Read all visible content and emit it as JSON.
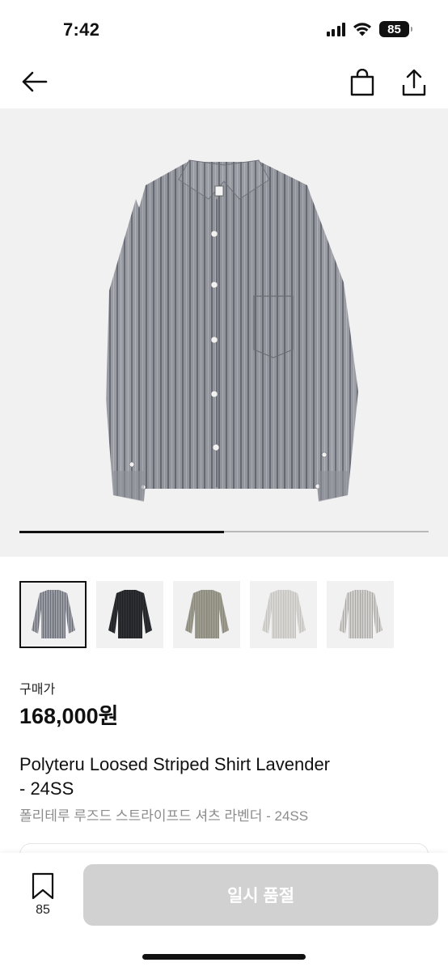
{
  "status_bar": {
    "time": "7:42",
    "battery": "85"
  },
  "nav": {
    "back_icon": "arrow-left-icon",
    "bag_icon": "shopping-bag-icon",
    "share_icon": "share-icon"
  },
  "hero": {
    "image": "gray-striped-shirt",
    "progress": 0.5
  },
  "thumbnails": [
    {
      "color": "gray-stripe",
      "selected": true
    },
    {
      "color": "black",
      "selected": false
    },
    {
      "color": "khaki",
      "selected": false
    },
    {
      "color": "light-gray",
      "selected": false
    },
    {
      "color": "light-gray-stripe",
      "selected": false
    }
  ],
  "price": {
    "label": "구매가",
    "value": "168,000원"
  },
  "product": {
    "title_en_line1": "Polyteru Loosed Striped Shirt Lavender",
    "title_en_line2": "- 24SS",
    "title_ko": "폴리테루 루즈드 스트라이프드 셔츠 라벤더 - 24SS"
  },
  "bottom": {
    "bookmark_count": "85",
    "cta_label": "일시 품절"
  },
  "colors": {
    "cta_bg": "#d1d1d1",
    "text": "#111111",
    "subtext": "#8c8c8c"
  }
}
